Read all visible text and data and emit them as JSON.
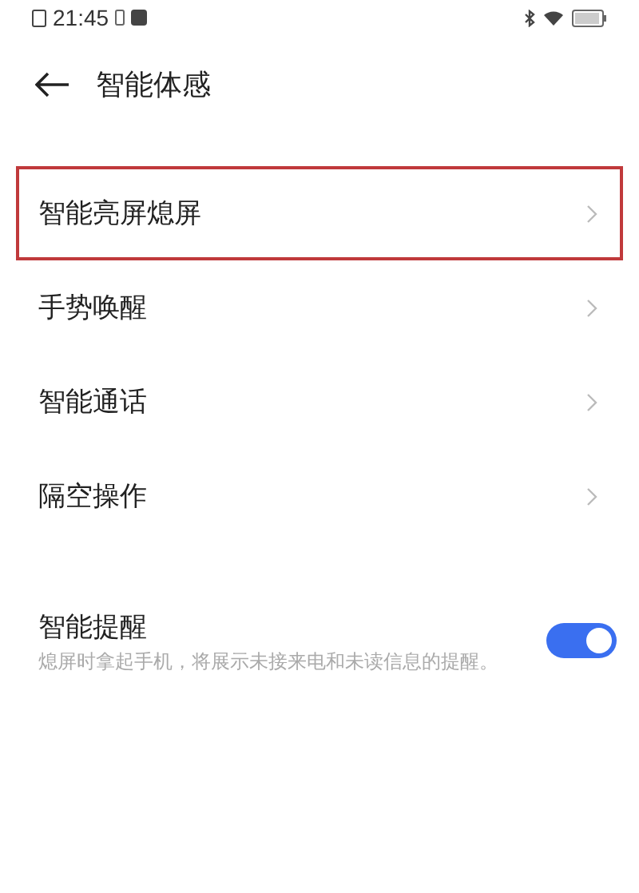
{
  "status_bar": {
    "time": "21:45"
  },
  "header": {
    "title": "智能体感"
  },
  "menu_items": [
    {
      "label": "智能亮屏熄屏",
      "highlighted": true
    },
    {
      "label": "手势唤醒",
      "highlighted": false
    },
    {
      "label": "智能通话",
      "highlighted": false
    },
    {
      "label": "隔空操作",
      "highlighted": false
    }
  ],
  "toggle_setting": {
    "title": "智能提醒",
    "description": "熄屏时拿起手机，将展示未接来电和未读信息的提醒。",
    "on": true
  }
}
